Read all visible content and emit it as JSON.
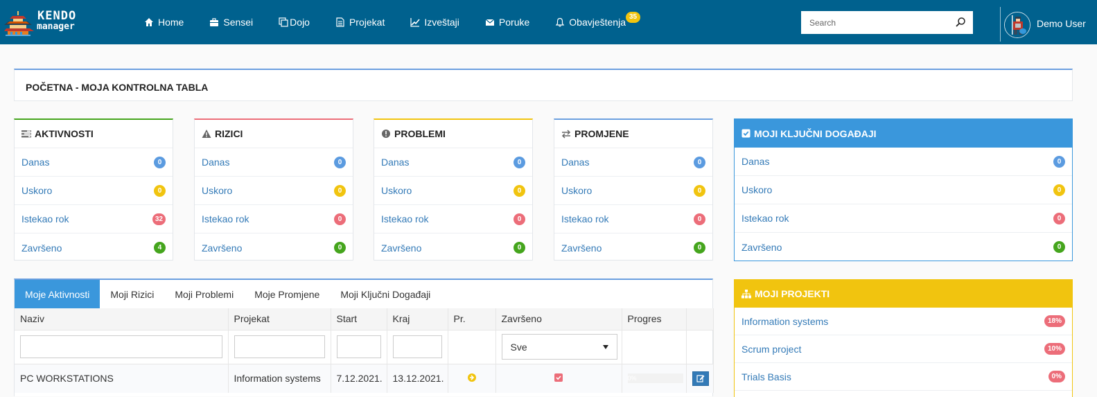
{
  "navbar": {
    "logo": {
      "line1": "KENDO",
      "line2": "manager"
    },
    "items": [
      {
        "label": "Home",
        "icon": "home-icon"
      },
      {
        "label": "Sensei",
        "icon": "briefcase-icon"
      },
      {
        "label": "Dojo",
        "icon": "clone-icon"
      },
      {
        "label": "Projekat",
        "icon": "file-text-icon"
      },
      {
        "label": "Izveštaji",
        "icon": "line-chart-icon"
      },
      {
        "label": "Poruke",
        "icon": "envelope-icon"
      },
      {
        "label": "Obavještenja",
        "icon": "bell-icon",
        "badge": "35"
      }
    ],
    "search": {
      "placeholder": "Search",
      "value": ""
    },
    "user": {
      "name": "Demo User"
    }
  },
  "page": {
    "title": "POČETNA - MOJA KONTROLNA TABLA"
  },
  "colors": {
    "navbar": "#00618e",
    "blue": "#5b9be0",
    "yellow": "#f1c40f",
    "red": "#ec6d79",
    "green": "#45a51d",
    "primary": "#3a97dc",
    "link": "#337ab7"
  },
  "stat_cards": [
    {
      "title": "AKTIVNOSTI",
      "icon": "tasks-icon",
      "accent": "#45a51d",
      "rows": [
        {
          "label": "Danas",
          "count": "0",
          "color": "blue"
        },
        {
          "label": "Uskoro",
          "count": "0",
          "color": "yellow"
        },
        {
          "label": "Istekao rok",
          "count": "32",
          "color": "red"
        },
        {
          "label": "Završeno",
          "count": "4",
          "color": "green"
        }
      ]
    },
    {
      "title": "RIZICI",
      "icon": "warning-icon",
      "accent": "#ec6d79",
      "rows": [
        {
          "label": "Danas",
          "count": "0",
          "color": "blue"
        },
        {
          "label": "Uskoro",
          "count": "0",
          "color": "yellow"
        },
        {
          "label": "Istekao rok",
          "count": "0",
          "color": "red"
        },
        {
          "label": "Završeno",
          "count": "0",
          "color": "green"
        }
      ]
    },
    {
      "title": "PROBLEMI",
      "icon": "exclamation-circle-icon",
      "accent": "#f1c40f",
      "rows": [
        {
          "label": "Danas",
          "count": "0",
          "color": "blue"
        },
        {
          "label": "Uskoro",
          "count": "0",
          "color": "yellow"
        },
        {
          "label": "Istekao rok",
          "count": "0",
          "color": "red"
        },
        {
          "label": "Završeno",
          "count": "0",
          "color": "green"
        }
      ]
    },
    {
      "title": "PROMJENE",
      "icon": "exchange-icon",
      "accent": "#6b9fdf",
      "rows": [
        {
          "label": "Danas",
          "count": "0",
          "color": "blue"
        },
        {
          "label": "Uskoro",
          "count": "0",
          "color": "yellow"
        },
        {
          "label": "Istekao rok",
          "count": "0",
          "color": "red"
        },
        {
          "label": "Završeno",
          "count": "0",
          "color": "green"
        }
      ]
    }
  ],
  "key_events": {
    "title": "MOJI KLJUČNI DOGAĐAJI",
    "icon": "check-square-icon",
    "rows": [
      {
        "label": "Danas",
        "count": "0",
        "color": "blue"
      },
      {
        "label": "Uskoro",
        "count": "0",
        "color": "yellow"
      },
      {
        "label": "Istekao rok",
        "count": "0",
        "color": "red"
      },
      {
        "label": "Završeno",
        "count": "0",
        "color": "green"
      }
    ]
  },
  "projects": {
    "title": "MOJI PROJEKTI",
    "icon": "sitemap-icon",
    "items": [
      {
        "name": "Information systems",
        "progress": "18%"
      },
      {
        "name": "Scrum project",
        "progress": "10%"
      },
      {
        "name": "Trials Basis",
        "progress": "0%"
      }
    ]
  },
  "tabs": [
    {
      "label": "Moje Aktivnosti",
      "active": true
    },
    {
      "label": "Moji Rizici",
      "active": false
    },
    {
      "label": "Moji Problemi",
      "active": false
    },
    {
      "label": "Moje Promjene",
      "active": false
    },
    {
      "label": "Moji Ključni Događaji",
      "active": false
    }
  ],
  "table": {
    "columns": [
      "Naziv",
      "Projekat",
      "Start",
      "Kraj",
      "Pr.",
      "Završeno",
      "Progres",
      ""
    ],
    "filters": {
      "naziv": "",
      "projekat": "",
      "start": "",
      "kraj": "",
      "zavrseno": "Sve"
    },
    "rows": [
      {
        "naziv": "PC WORKSTATIONS",
        "projekat": "Information systems",
        "start": "7.12.2021.",
        "kraj": "13.12.2021.",
        "priority_icon": "arrow-circle-right-icon",
        "zavrseno_icon": "checked-box-icon",
        "progress": "0%"
      }
    ]
  }
}
